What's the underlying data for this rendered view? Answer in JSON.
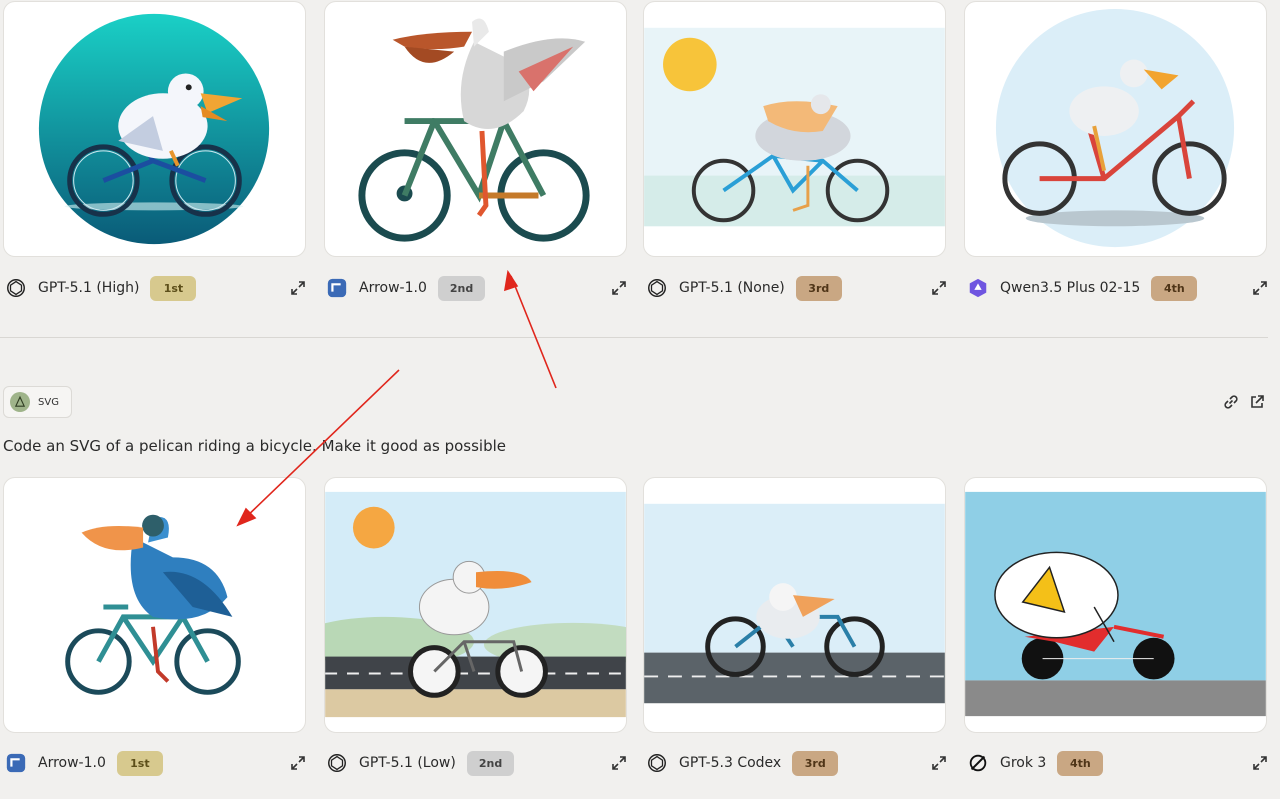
{
  "top_row": [
    {
      "model": "GPT-5.1 (High)",
      "rank": "1st",
      "logo": "openai-icon",
      "rank_bg": "#d7c98e"
    },
    {
      "model": "Arrow-1.0",
      "rank": "2nd",
      "logo": "arrow-logo-icon",
      "rank_bg": "#cfcfcf"
    },
    {
      "model": "GPT-5.1 (None)",
      "rank": "3rd",
      "logo": "openai-icon",
      "rank_bg": "#c9a783"
    },
    {
      "model": "Qwen3.5 Plus 02-15",
      "rank": "4th",
      "logo": "qwen-icon",
      "rank_bg": "#c9a783"
    }
  ],
  "section": {
    "tag_label": "SVG",
    "prompt": "Code an SVG of a pelican riding a bicycle. Make it good as possible",
    "link_icon": "link-icon",
    "open_icon": "external-link-icon"
  },
  "bottom_row": [
    {
      "model": "Arrow-1.0",
      "rank": "1st",
      "logo": "arrow-logo-icon",
      "rank_bg": "#d7c98e"
    },
    {
      "model": "GPT-5.1 (Low)",
      "rank": "2nd",
      "logo": "openai-icon",
      "rank_bg": "#cfcfcf"
    },
    {
      "model": "GPT-5.3 Codex",
      "rank": "3rd",
      "logo": "openai-icon",
      "rank_bg": "#c9a783"
    },
    {
      "model": "Grok 3",
      "rank": "4th",
      "logo": "grok-icon",
      "rank_bg": "#c9a783"
    }
  ],
  "annotation_color": "#e0261c"
}
